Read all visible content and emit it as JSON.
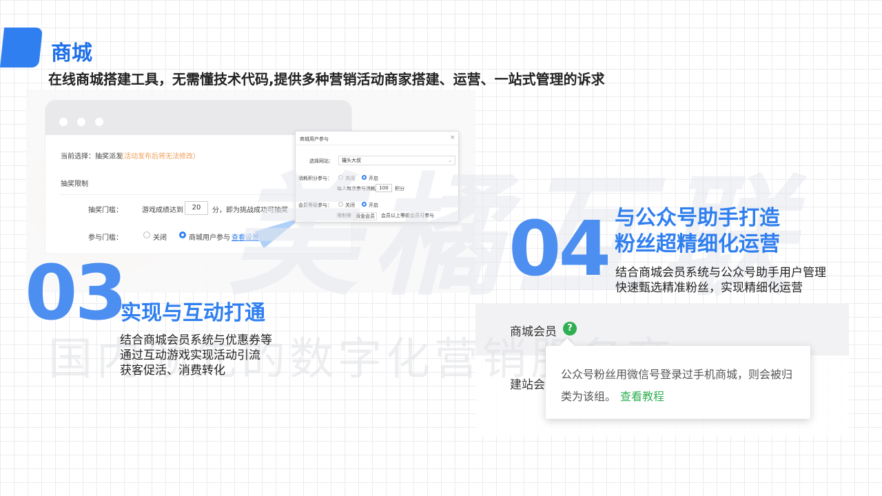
{
  "header": {
    "title": "商城",
    "subtitle": "在线商城搭建工具，无需懂技术代码,提供多种营销活动商家搭建、运营、一站式管理的诉求"
  },
  "watermark": {
    "brand": "美橘互联",
    "slogan": "国内领先的数字化营销服务商"
  },
  "mockup_left": {
    "current_label": "当前选择：抽奖派发",
    "current_note": "（活动发布后将无法修改）",
    "section_title": "抽奖限制",
    "threshold_label": "抽奖门槛：",
    "threshold_prefix": "游戏成绩达到",
    "threshold_value": "20",
    "threshold_suffix": "分，即为挑战成功可抽奖",
    "join_label": "参与门槛：",
    "option_off": "关闭",
    "option_users": "商城用户参与",
    "view_settings": "查看设置"
  },
  "dialog": {
    "title": "商城用户参与",
    "site_label": "选择网站：",
    "site_value": "撮头大叔",
    "points_label": "消耗积分参与：",
    "off": "关闭",
    "on": "开启",
    "per_time": "每人每次参与消耗",
    "points_value": "100",
    "points_unit": "积分",
    "member_label": "会员等级参与：",
    "limit_label": "限制需",
    "limit_value": "黄金会员",
    "limit_suffix": "会员以上等级会员可参与"
  },
  "section03": {
    "number": "03",
    "heading": "实现与互动打通",
    "lines": [
      "结合商城会员系统与优惠券等",
      "通过互动游戏实现活动引流",
      "获客促活、消费转化"
    ]
  },
  "section04": {
    "number": "04",
    "heading_lines": [
      "与公众号助手打造",
      "粉丝超精细化运营"
    ],
    "lines": [
      "结合商城会员系统与公众号助手用户管理",
      "快速甄选精准粉丝，实现精细化运营"
    ]
  },
  "mockup_right": {
    "member_label": "商城会员",
    "help_icon": "?",
    "site_label": "建站会",
    "tooltip_text": "公众号粉丝用微信号登录过手机商城，则会被归类为该组。",
    "tooltip_link": "查看教程"
  },
  "colors": {
    "accent": "#2f7ff0",
    "number": "#4d8ff0",
    "green": "#2fae52",
    "orange": "#f0a05a"
  }
}
